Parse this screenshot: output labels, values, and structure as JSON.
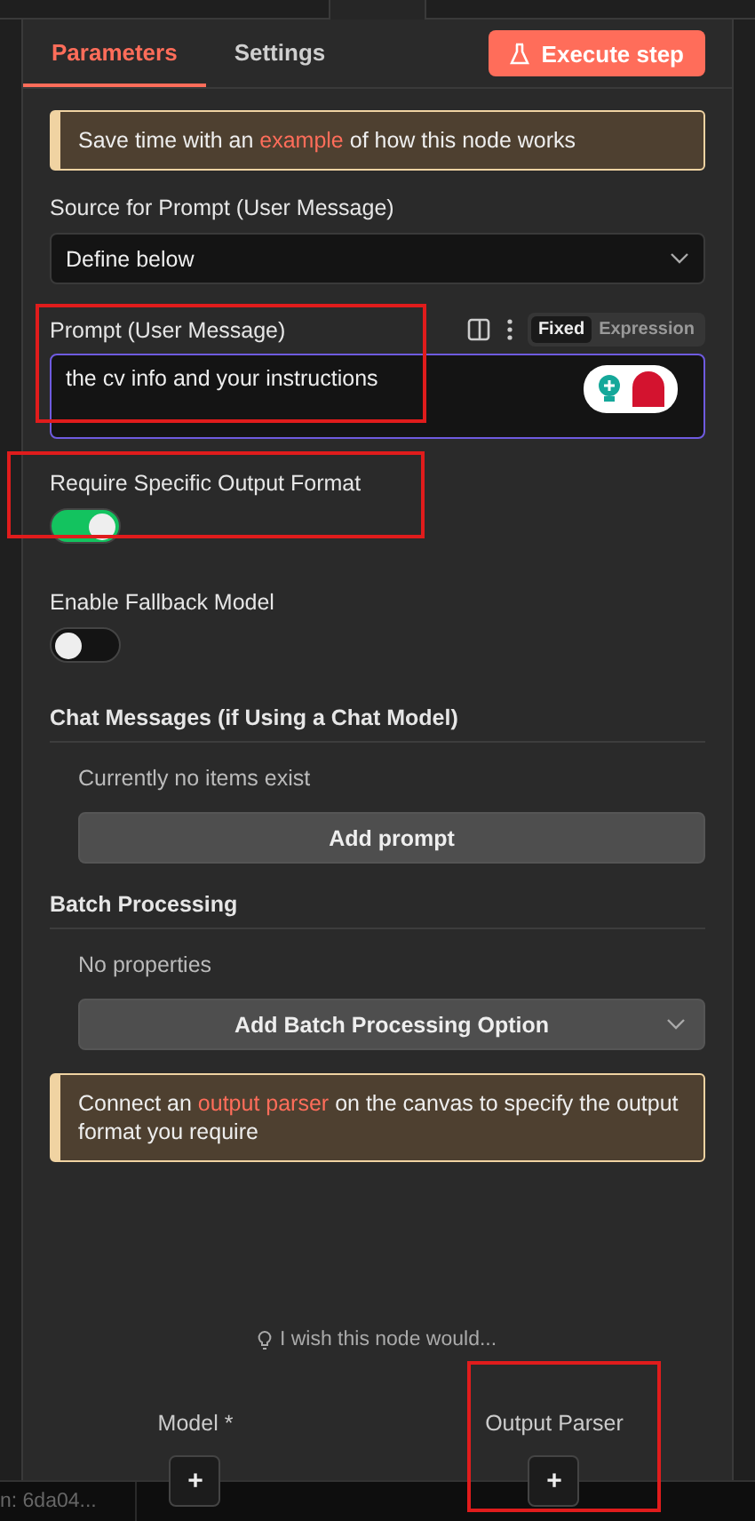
{
  "tabs": [
    {
      "label": "Parameters",
      "selected": true
    },
    {
      "label": "Settings",
      "selected": false
    }
  ],
  "execute_button": "Execute step",
  "example_notice": "Save time with an **example** of how this node works",
  "source": {
    "label": "Source for Prompt (User Message)",
    "value": "Define below"
  },
  "prompt": {
    "label": "Prompt (User Message)",
    "modes": [
      {
        "label": "Fixed",
        "selected": true
      },
      {
        "label": "Expression",
        "selected": false
      }
    ],
    "value": "the cv info and your instructions"
  },
  "toggles": [
    {
      "label": "Require Specific Output Format",
      "on": true
    },
    {
      "label": "Enable Fallback Model",
      "on": false
    }
  ],
  "collections": [
    {
      "heading": "Chat Messages (if Using a Chat Model)",
      "empty_text": "Currently no items exist",
      "button": "Add prompt",
      "dropdown": false
    },
    {
      "heading": "Batch Processing",
      "empty_text": "No properties",
      "button": "Add Batch Processing Option",
      "dropdown": true
    }
  ],
  "parser_notice": "Connect an **output parser** on the canvas to specify the output format you require",
  "feedback_link": "I wish this node would...",
  "connectors": [
    {
      "label": "Model *",
      "button": "+"
    },
    {
      "label": "Output Parser",
      "button": "+"
    }
  ],
  "status_bar": {
    "text": "n: 6da04..."
  }
}
